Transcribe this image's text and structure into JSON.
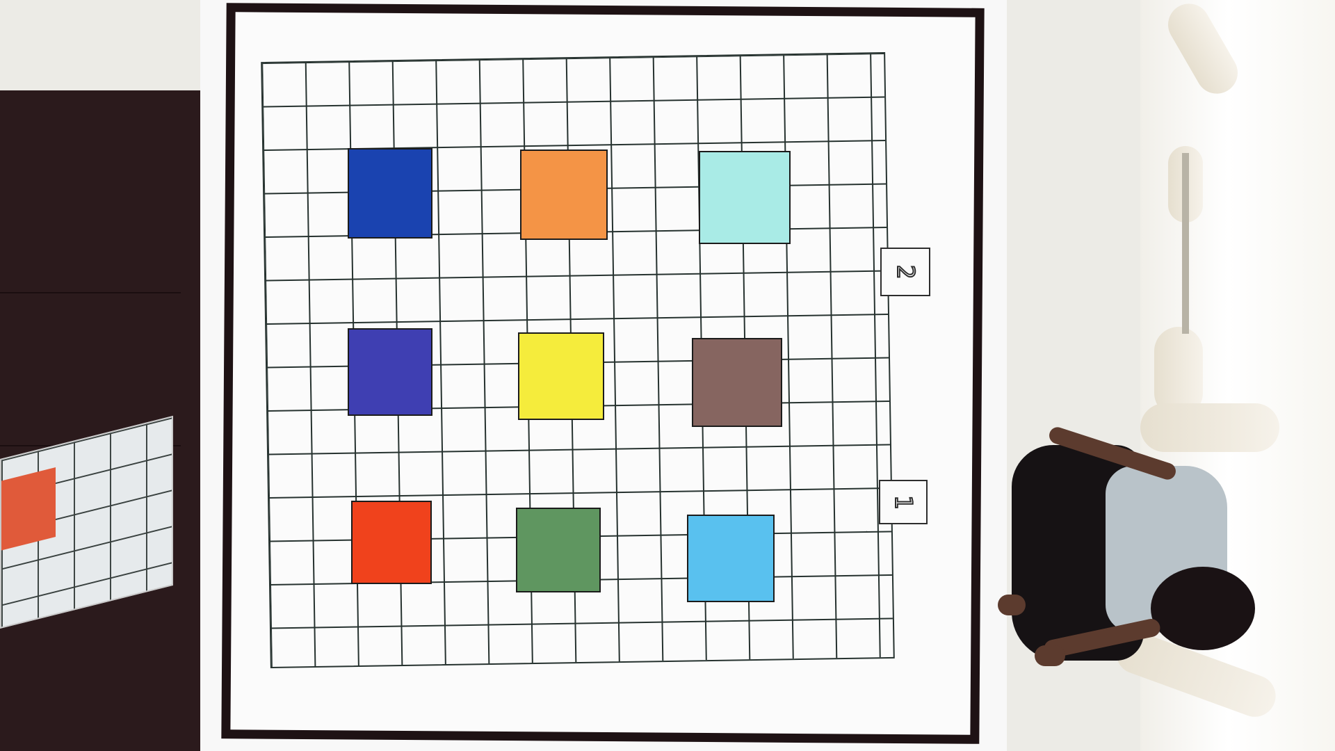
{
  "scene": {
    "description_labels": {
      "label_1": "1",
      "label_2": "2"
    },
    "tiles": [
      {
        "name": "blue-tile",
        "color": "#1a43b0"
      },
      {
        "name": "orange-tile",
        "color": "#f49446"
      },
      {
        "name": "cyan-tile",
        "color": "#a9ebe6"
      },
      {
        "name": "indigo-tile",
        "color": "#3f3fb2"
      },
      {
        "name": "yellow-tile",
        "color": "#f5ec3c"
      },
      {
        "name": "brown-tile",
        "color": "#866560"
      },
      {
        "name": "red-tile",
        "color": "#f0421c"
      },
      {
        "name": "green-tile",
        "color": "#5f9660"
      },
      {
        "name": "sky-blue-tile",
        "color": "#59c1ef"
      }
    ],
    "colors": {
      "board_border": "#1e1214",
      "grid_line": "#26322f",
      "mat": "#f8f8f8",
      "cabinet": "#2b1a1c"
    }
  }
}
